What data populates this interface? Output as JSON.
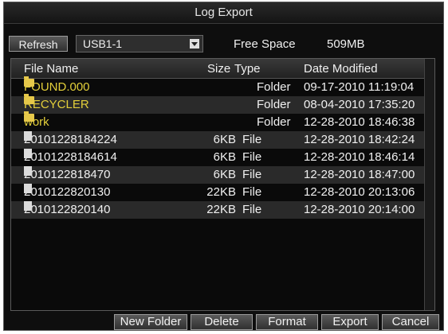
{
  "window": {
    "title": "Log Export"
  },
  "toolbar": {
    "refresh_label": "Refresh",
    "device_selected": "USB1-1",
    "free_space_label": "Free Space",
    "free_space_value": "509MB"
  },
  "table": {
    "headers": {
      "name": "File Name",
      "size": "Size",
      "type": "Type",
      "date": "Date Modified"
    },
    "rows": [
      {
        "icon": "folder-icon",
        "name": "FOUND.000",
        "size": "",
        "type": "Folder",
        "date": "09-17-2010 11:19:04"
      },
      {
        "icon": "folder-icon",
        "name": "RECYCLER",
        "size": "",
        "type": "Folder",
        "date": "08-04-2010 17:35:20"
      },
      {
        "icon": "folder-icon",
        "name": "work",
        "size": "",
        "type": "Folder",
        "date": "12-28-2010 18:46:38"
      },
      {
        "icon": "file-icon",
        "name": "20101228184224",
        "size": "6KB",
        "type": "File",
        "date": "12-28-2010 18:42:24"
      },
      {
        "icon": "file-icon",
        "name": "20101228184614",
        "size": "6KB",
        "type": "File",
        "date": "12-28-2010 18:46:14"
      },
      {
        "icon": "file-icon",
        "name": "2010122818470",
        "size": "6KB",
        "type": "File",
        "date": "12-28-2010 18:47:00"
      },
      {
        "icon": "file-icon",
        "name": "2010122820130",
        "size": "22KB",
        "type": "File",
        "date": "12-28-2010 20:13:06"
      },
      {
        "icon": "file-icon",
        "name": "2010122820140",
        "size": "22KB",
        "type": "File",
        "date": "12-28-2010 20:14:00"
      }
    ]
  },
  "buttons": {
    "new_folder": "New Folder",
    "delete": "Delete",
    "format": "Format",
    "export": "Export",
    "cancel": "Cancel"
  },
  "colors": {
    "folder_text": "#e3cf3a",
    "background": "#0e0e0e"
  }
}
